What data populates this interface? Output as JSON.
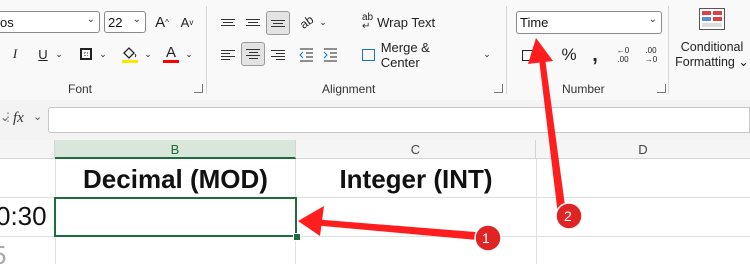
{
  "ribbon": {
    "font": {
      "font_name_partial": "os",
      "font_size": "22",
      "grow_icon": "A",
      "shrink_icon": "A",
      "italic": "I",
      "underline": "U",
      "font_color_letter": "A",
      "label": "Font"
    },
    "alignment": {
      "wrap_text": "Wrap Text",
      "merge_center": "Merge & Center",
      "label": "Alignment"
    },
    "number": {
      "format": "Time",
      "percent": "%",
      "comma": "❩",
      "increase_decimal_top": "←0",
      "increase_decimal_bottom": ".00",
      "decrease_decimal_top": ".00",
      "decrease_decimal_bottom": "→0",
      "label": "Number"
    },
    "styles": {
      "conditional_formatting_line1": "Conditional",
      "conditional_formatting_line2": "Formatting"
    }
  },
  "formula_bar": {
    "fx_label": "fx",
    "value": ""
  },
  "columns": [
    "B",
    "C",
    "D"
  ],
  "cells": {
    "B_header": "Decimal (MOD)",
    "C_header": "Integer (INT)",
    "A_row2_partial": "0:30",
    "A_row3_partial": "5"
  },
  "callouts": [
    "1",
    "2"
  ],
  "colors": {
    "accent_green": "#1e6b3b",
    "callout_red": "#e02424",
    "arrow_red": "#ff1e1e"
  }
}
